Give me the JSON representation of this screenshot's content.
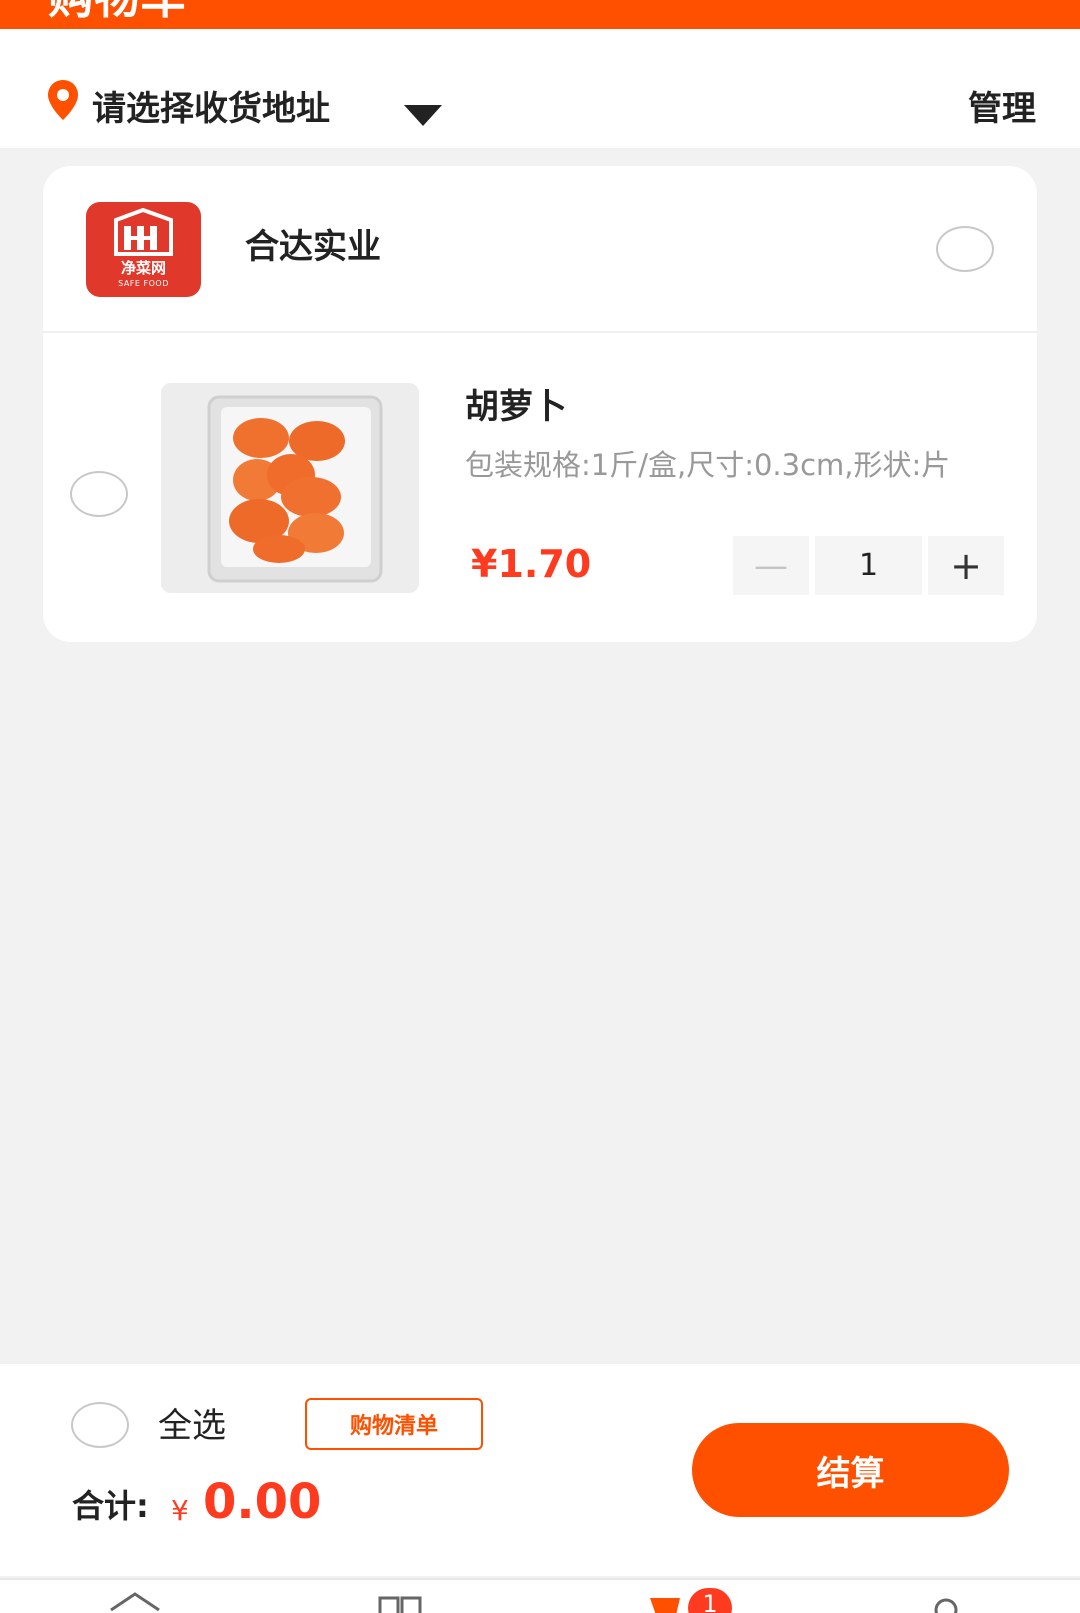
{
  "header": {
    "title": "购物车"
  },
  "address": {
    "prompt": "请选择收货地址",
    "manage_label": "管理"
  },
  "store": {
    "name": "合达实业",
    "logo_text_cn": "净菜网",
    "logo_text_en": "SAFE FOOD"
  },
  "cart_items": [
    {
      "name": "胡萝卜",
      "spec": "包装规格:1斤/盒,尺寸:0.3cm,形状:片",
      "price": "¥1.70",
      "quantity": "1",
      "minus_label": "—",
      "plus_label": "+"
    }
  ],
  "summary": {
    "select_all_label": "全选",
    "shopping_list_label": "购物清单",
    "total_label": "合计:",
    "currency": "¥",
    "total_value": "0.00",
    "checkout_label": "结算"
  },
  "tabbar": {
    "cart_badge": "1"
  },
  "colors": {
    "brand": "#ff5000",
    "price": "#ff3b1f"
  }
}
